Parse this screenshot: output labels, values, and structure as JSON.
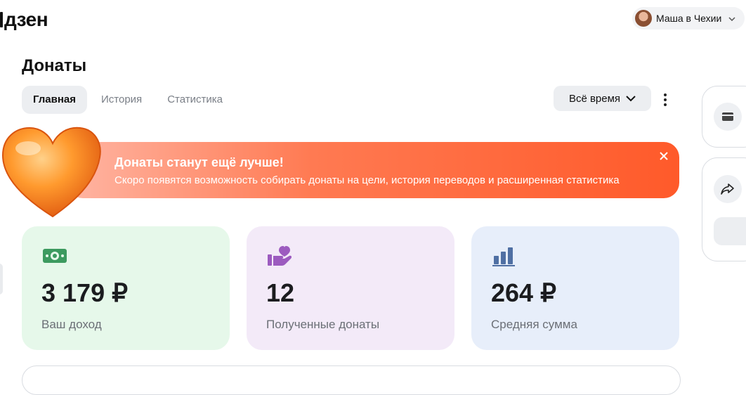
{
  "header": {
    "logo_text": "дзен",
    "profile_name": "Маша в Чехии"
  },
  "page": {
    "title": "Донаты",
    "tabs": [
      {
        "label": "Главная",
        "active": true
      },
      {
        "label": "История",
        "active": false
      },
      {
        "label": "Статистика",
        "active": false
      }
    ],
    "period_label": "Всё время"
  },
  "banner": {
    "title": "Донаты станут ещё лучше!",
    "text": "Скоро появятся возможность собирать донаты на цели, история переводов и расширенная статистика"
  },
  "stats": [
    {
      "icon": "money-icon",
      "value": "3 179 ₽",
      "label": "Ваш доход"
    },
    {
      "icon": "donation-hand-icon",
      "value": "12",
      "label": "Полученные донаты"
    },
    {
      "icon": "bar-chart-icon",
      "value": "264 ₽",
      "label": "Средняя сумма"
    }
  ],
  "colors": {
    "income_card": "#e6f8ea",
    "donations_card": "#f3eaf8",
    "average_card": "#e7eefa",
    "banner_accent": "#ff5a2a"
  }
}
